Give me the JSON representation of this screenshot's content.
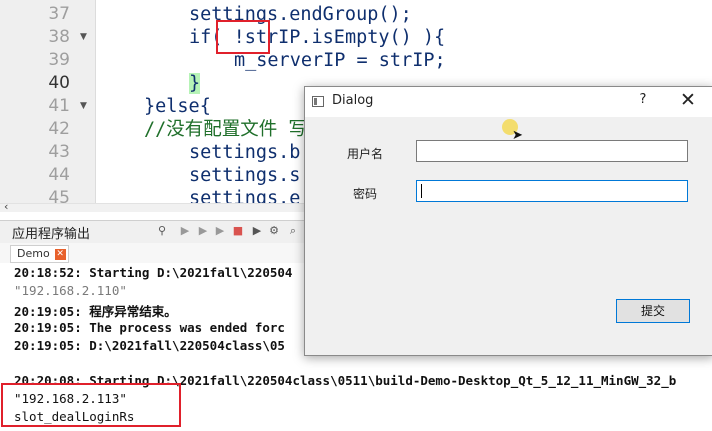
{
  "editor": {
    "line_numbers": [
      "37",
      "38",
      "39",
      "40",
      "41",
      "42",
      "43",
      "44",
      "45"
    ],
    "lines": [
      {
        "pre": "settings.endGroup();"
      },
      {
        "pre": "if( ",
        "mid": "!strIP.isEmpty() ){"
      },
      {
        "pre": "m_serverIP = strIP;"
      },
      {
        "pre": "}"
      },
      {
        "pre": "}else{"
      },
      {
        "pre": "//没有配置文件 写"
      },
      {
        "pre": "settings.b"
      },
      {
        "pre": "settings.s"
      },
      {
        "pre": "settings.e"
      }
    ]
  },
  "output": {
    "title": "应用程序输出",
    "tab": "Demo",
    "lines": [
      "20:18:52: Starting D:\\2021fall\\220504",
      "\"192.168.2.110\"",
      "20:19:05: 程序异常结束。",
      "20:19:05: The process was ended forc",
      "20:19:05: D:\\2021fall\\220504class\\05",
      "20:20:08: Starting D:\\2021fall\\220504class\\0511\\build-Demo-Desktop_Qt_5_12_11_MinGW_32_b",
      "\"192.168.2.113\"",
      "slot_dealLoginRs"
    ]
  },
  "dialog": {
    "title": "Dialog",
    "help": "?",
    "close": "✕",
    "username_label": "用户名",
    "password_label": "密码",
    "username_value": "",
    "password_value": "",
    "submit_label": "提交"
  }
}
